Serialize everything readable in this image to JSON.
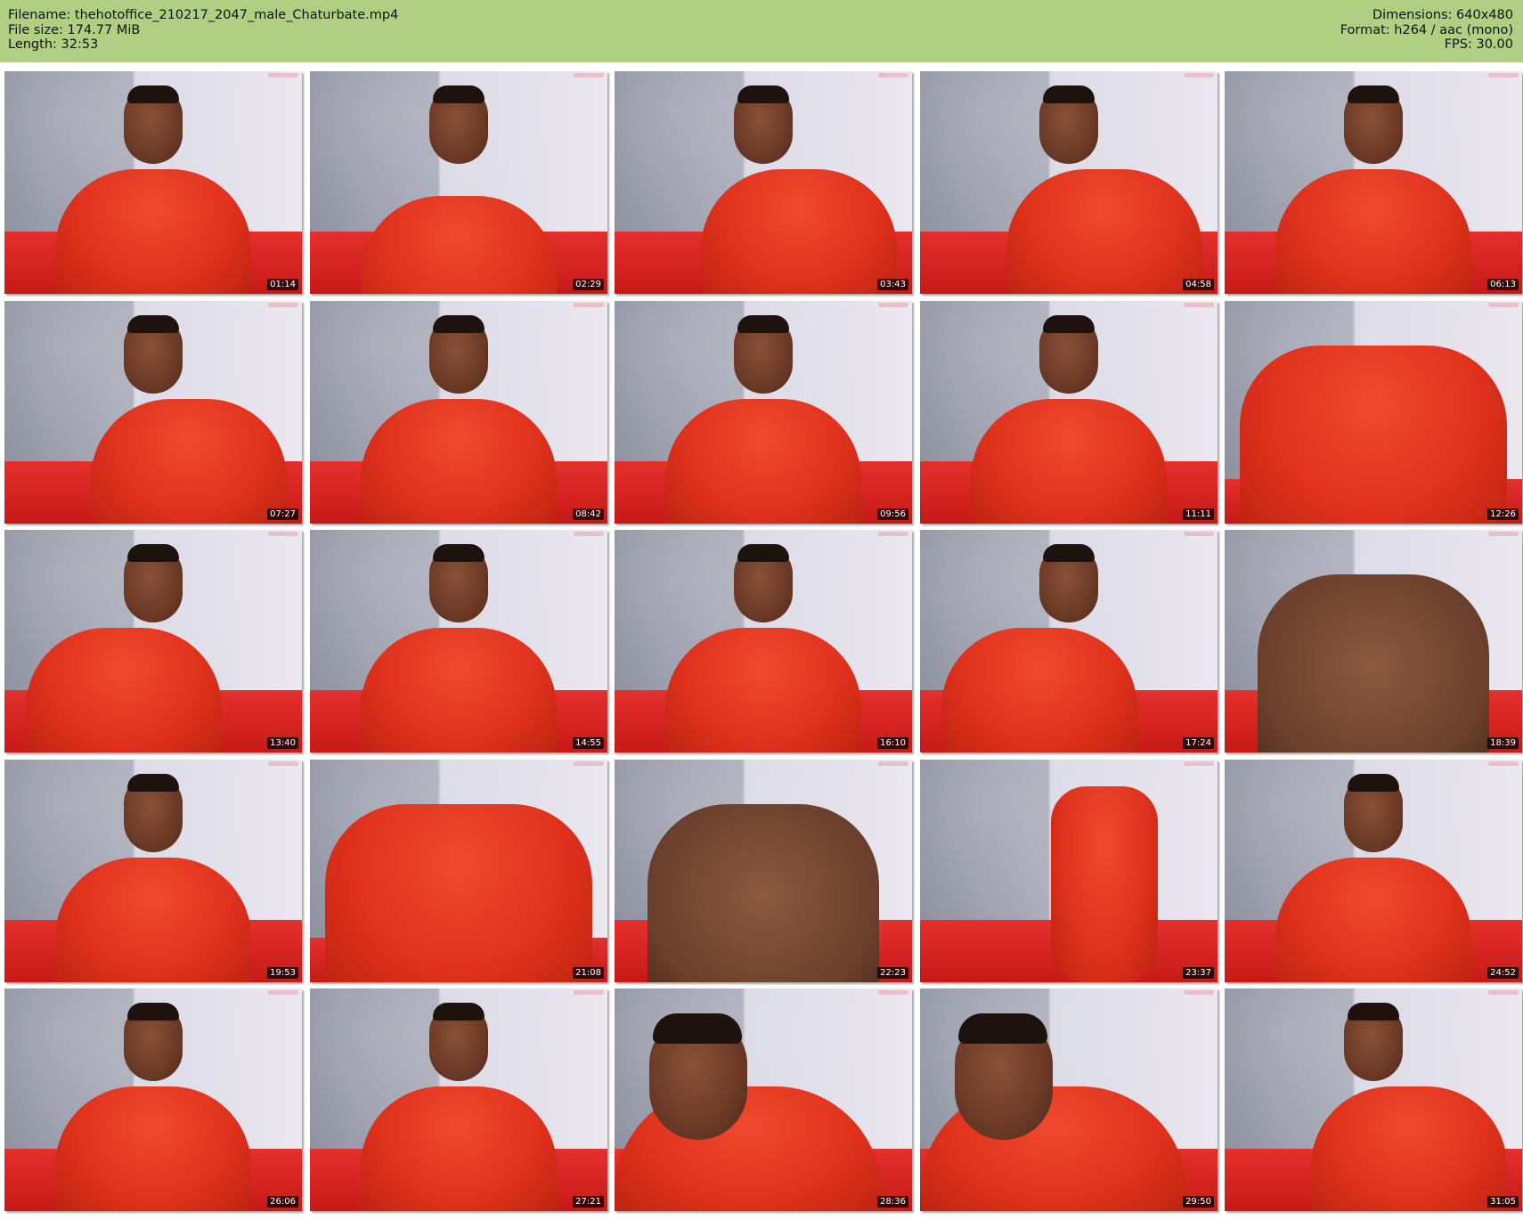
{
  "header": {
    "filename_line": "Filename: thehotoffice_210217_2047_male_Chaturbate.mp4",
    "filesize_line": "File size: 174.77 MiB",
    "length_line": "Length: 32:53",
    "dimensions_line": "Dimensions: 640x480",
    "format_line": "Format: h264 / aac (mono)",
    "fps_line": "FPS: 30.00"
  },
  "colors": {
    "header_background": "#b1cf83",
    "shirt": "#e0321d",
    "sofa": "#d62521"
  },
  "thumbnails": [
    {
      "timestamp": "01:14",
      "variant": "normal"
    },
    {
      "timestamp": "02:29",
      "variant": "low"
    },
    {
      "timestamp": "03:43",
      "variant": "right"
    },
    {
      "timestamp": "04:58",
      "variant": "right"
    },
    {
      "timestamp": "06:13",
      "variant": "normal"
    },
    {
      "timestamp": "07:27",
      "variant": "right"
    },
    {
      "timestamp": "08:42",
      "variant": "normal"
    },
    {
      "timestamp": "09:56",
      "variant": "normal"
    },
    {
      "timestamp": "11:11",
      "variant": "normal"
    },
    {
      "timestamp": "12:26",
      "variant": "close"
    },
    {
      "timestamp": "13:40",
      "variant": "left"
    },
    {
      "timestamp": "14:55",
      "variant": "normal"
    },
    {
      "timestamp": "16:10",
      "variant": "normal"
    },
    {
      "timestamp": "17:24",
      "variant": "left"
    },
    {
      "timestamp": "18:39",
      "variant": "bare"
    },
    {
      "timestamp": "19:53",
      "variant": "normal"
    },
    {
      "timestamp": "21:08",
      "variant": "close"
    },
    {
      "timestamp": "22:23",
      "variant": "bare"
    },
    {
      "timestamp": "23:37",
      "variant": "leg"
    },
    {
      "timestamp": "24:52",
      "variant": "normal"
    },
    {
      "timestamp": "26:06",
      "variant": "normal"
    },
    {
      "timestamp": "27:21",
      "variant": "normal"
    },
    {
      "timestamp": "28:36",
      "variant": "lie"
    },
    {
      "timestamp": "29:50",
      "variant": "lie"
    },
    {
      "timestamp": "31:05",
      "variant": "right"
    }
  ]
}
